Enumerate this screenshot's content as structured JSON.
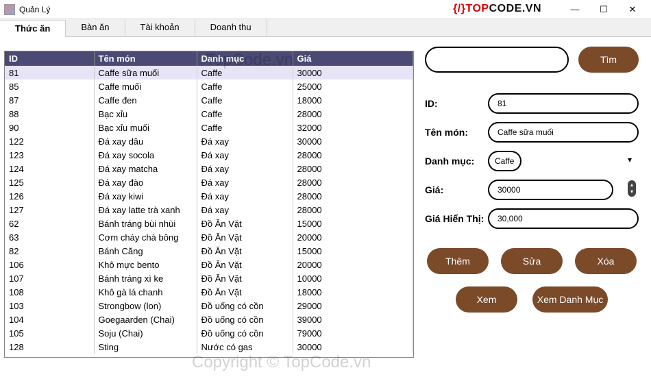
{
  "window": {
    "title": "Quản Lý",
    "min": "—",
    "max": "☐",
    "close": "✕"
  },
  "logo": {
    "code": "{/}",
    "top": "TOP",
    "code_t": "CODE",
    "vn": ".VN"
  },
  "watermark1": "TopCode.vn",
  "watermark2": "Copyright © TopCode.vn",
  "tabs": [
    {
      "label": "Thức ăn",
      "active": true
    },
    {
      "label": "Bàn ăn"
    },
    {
      "label": "Tài khoản"
    },
    {
      "label": "Doanh thu"
    }
  ],
  "grid": {
    "headers": {
      "id": "ID",
      "name": "Tên món",
      "cat": "Danh mục",
      "price": "Giá"
    },
    "rows": [
      {
        "id": "81",
        "name": "Caffe sữa muối",
        "cat": "Caffe",
        "price": "30000",
        "selected": true
      },
      {
        "id": "85",
        "name": "Caffe muối",
        "cat": "Caffe",
        "price": "25000"
      },
      {
        "id": "87",
        "name": "Caffe đen",
        "cat": "Caffe",
        "price": "18000"
      },
      {
        "id": "88",
        "name": "Bạc xỉu",
        "cat": "Caffe",
        "price": "28000"
      },
      {
        "id": "90",
        "name": "Bạc xỉu muối",
        "cat": "Caffe",
        "price": "32000"
      },
      {
        "id": "122",
        "name": "Đá xay dâu",
        "cat": "Đá xay",
        "price": "30000"
      },
      {
        "id": "123",
        "name": "Đá xay socola",
        "cat": "Đá xay",
        "price": "28000"
      },
      {
        "id": "124",
        "name": "Đá xay matcha",
        "cat": "Đá xay",
        "price": "28000"
      },
      {
        "id": "125",
        "name": "Đá xay đào",
        "cat": "Đá xay",
        "price": "28000"
      },
      {
        "id": "126",
        "name": "Đá xay kiwi",
        "cat": "Đá xay",
        "price": "28000"
      },
      {
        "id": "127",
        "name": "Đá xay latte trà xanh",
        "cat": "Đá xay",
        "price": "28000"
      },
      {
        "id": "62",
        "name": "Bánh tráng bùi nhùi",
        "cat": "Đồ Ăn Vặt",
        "price": "15000"
      },
      {
        "id": "63",
        "name": "Cơm cháy chà bông",
        "cat": "Đồ Ăn Vặt",
        "price": "20000"
      },
      {
        "id": "82",
        "name": "Bánh Căng",
        "cat": "Đồ Ăn Vặt",
        "price": "15000"
      },
      {
        "id": "106",
        "name": "Khô mực bento",
        "cat": "Đồ Ăn Vặt",
        "price": "20000"
      },
      {
        "id": "107",
        "name": "Bánh tráng xì ke",
        "cat": "Đồ Ăn Vặt",
        "price": "10000"
      },
      {
        "id": "108",
        "name": "Khô gà lá chanh",
        "cat": "Đồ Ăn Vặt",
        "price": "18000"
      },
      {
        "id": "103",
        "name": "Strongbow (lon)",
        "cat": "Đồ uống có cồn",
        "price": "29000"
      },
      {
        "id": "104",
        "name": "Goegaarden (Chai)",
        "cat": "Đồ uống có cồn",
        "price": "39000"
      },
      {
        "id": "105",
        "name": "Soju (Chai)",
        "cat": "Đồ uống có cồn",
        "price": "79000"
      },
      {
        "id": "128",
        "name": "Sting",
        "cat": "Nước có gas",
        "price": "30000"
      }
    ]
  },
  "search": {
    "value": "",
    "btn": "Tìm"
  },
  "form": {
    "id_label": "ID:",
    "id_value": "81",
    "name_label": "Tên món:",
    "name_value": "Caffe sữa muối",
    "cat_label": "Danh mục:",
    "cat_value": "Caffe",
    "price_label": "Giá:",
    "price_value": "30000",
    "disp_label": "Giá Hiển Thị:",
    "disp_value": "30,000"
  },
  "buttons": {
    "add": "Thêm",
    "edit": "Sửa",
    "del": "Xóa",
    "view": "Xem",
    "viewcat": "Xem Danh Mục"
  }
}
